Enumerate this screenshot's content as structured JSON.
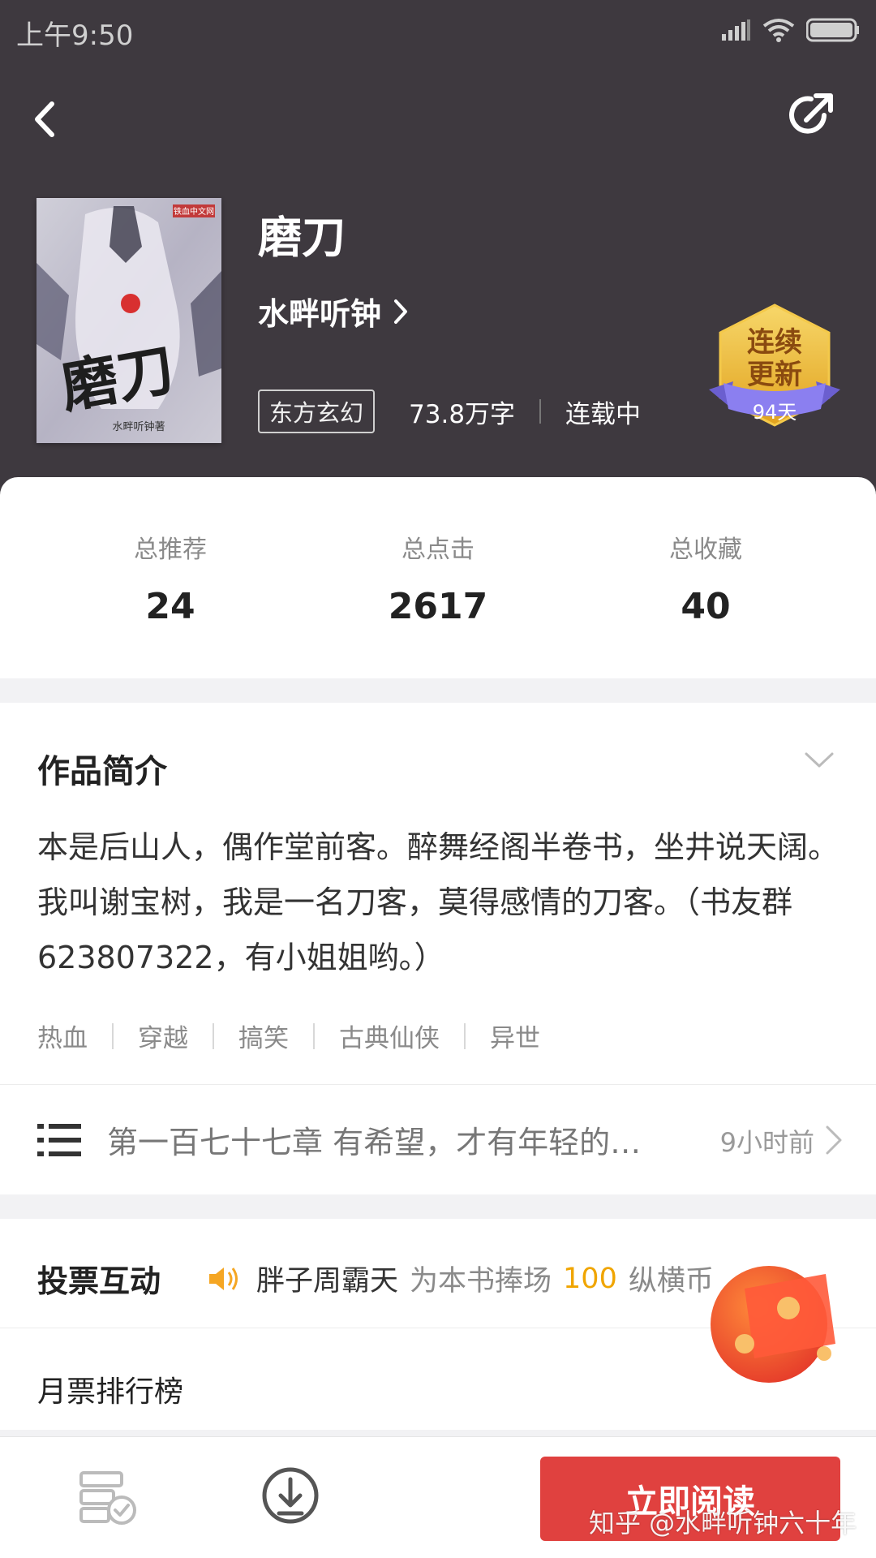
{
  "status_bar": {
    "time": "上午9:50"
  },
  "book": {
    "title": "磨刀",
    "author": "水畔听钟",
    "genre": "东方玄幻",
    "word_count": "73.8万字",
    "status": "连载中",
    "cover": {
      "title_text": "磨刀",
      "publisher": "铁血中文网",
      "author_sig": "水畔听钟著"
    }
  },
  "badge": {
    "line1": "连续",
    "line2": "更新",
    "days": "94天"
  },
  "stats": [
    {
      "label": "总推荐",
      "value": "24"
    },
    {
      "label": "总点击",
      "value": "2617"
    },
    {
      "label": "总收藏",
      "value": "40"
    }
  ],
  "intro": {
    "title": "作品简介",
    "text": "本是后山人，偶作堂前客。醉舞经阁半卷书，坐井说天阔。我叫谢宝树，我是一名刀客，莫得感情的刀客。（书友群623807322，有小姐姐哟。）",
    "tags": [
      "热血",
      "穿越",
      "搞笑",
      "古典仙侠",
      "异世"
    ]
  },
  "latest_chapter": {
    "name": "第一百七十七章 有希望，才有年轻的…",
    "time": "9小时前"
  },
  "vote": {
    "title": "投票互动",
    "voter": "胖子周霸天",
    "action": "为本书捧场",
    "amount": "100",
    "currency": "纵横币",
    "monthly_rank": "月票排行榜"
  },
  "bottom": {
    "read_button": "立即阅读"
  },
  "watermark": "知乎 @水畔听钟六十年",
  "colors": {
    "header_bg": "#3e393f",
    "accent_red": "#e0413f",
    "amount_gold": "#f0a500"
  }
}
